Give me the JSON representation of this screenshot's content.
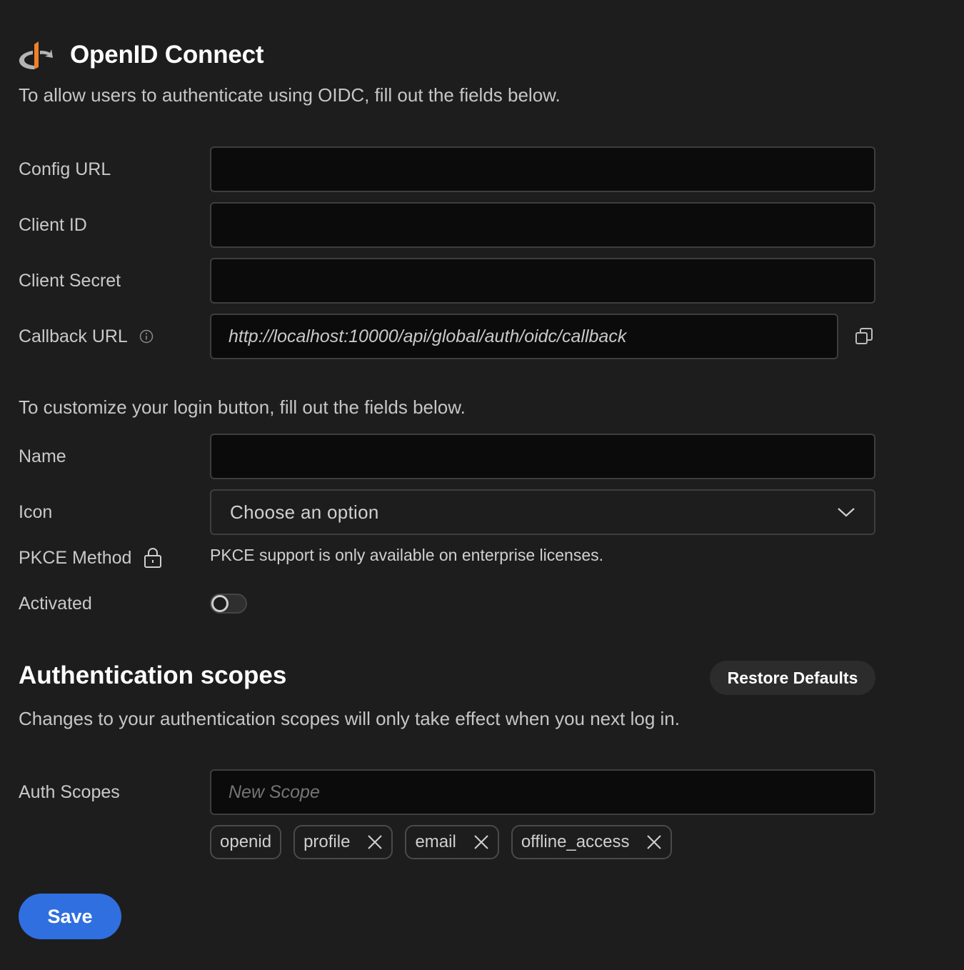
{
  "header": {
    "title": "OpenID Connect",
    "description": "To allow users to authenticate using OIDC, fill out the fields below."
  },
  "fields": {
    "config_url": {
      "label": "Config URL",
      "value": ""
    },
    "client_id": {
      "label": "Client ID",
      "value": ""
    },
    "client_secret": {
      "label": "Client Secret",
      "value": ""
    },
    "callback_url": {
      "label": "Callback URL",
      "value": "http://localhost:10000/api/global/auth/oidc/callback"
    }
  },
  "login_button": {
    "description": "To customize your login button, fill out the fields below.",
    "name_label": "Name",
    "name_value": "",
    "icon_label": "Icon",
    "icon_selected": "Choose an option",
    "pkce_label": "PKCE Method",
    "pkce_text": "PKCE support is only available on enterprise licenses.",
    "activated_label": "Activated",
    "activated": false
  },
  "scopes": {
    "title": "Authentication scopes",
    "restore_label": "Restore Defaults",
    "description": "Changes to your authentication scopes will only take effect when you next log in.",
    "label": "Auth Scopes",
    "placeholder": "New Scope",
    "chips": [
      {
        "label": "openid",
        "removable": false
      },
      {
        "label": "profile",
        "removable": true
      },
      {
        "label": "email",
        "removable": true
      },
      {
        "label": "offline_access",
        "removable": true
      }
    ]
  },
  "actions": {
    "save_label": "Save"
  },
  "colors": {
    "background": "#1d1d1d",
    "input_bg": "#0b0b0b",
    "primary": "#2f6fe0",
    "logo_orange": "#f0802a",
    "logo_gray": "#b4b4b4"
  }
}
